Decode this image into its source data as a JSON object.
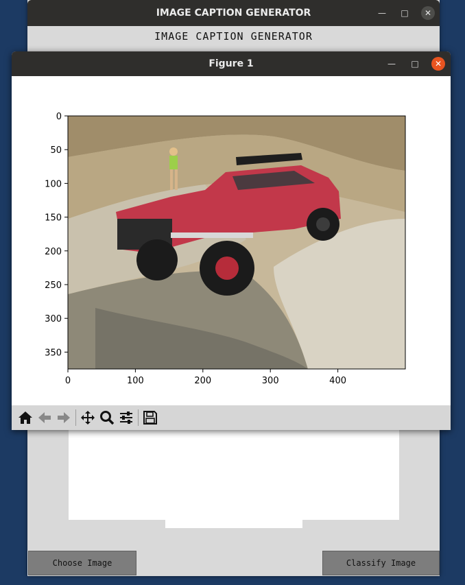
{
  "main_window": {
    "title": "IMAGE CAPTION GENERATOR",
    "header_label": "IMAGE CAPTION GENERATOR",
    "choose_button": "Choose Image",
    "classify_button": "Classify Image"
  },
  "figure_window": {
    "title": "Figure 1",
    "plot": {
      "x_ticks": [
        "0",
        "100",
        "200",
        "300",
        "400"
      ],
      "y_ticks": [
        "0",
        "50",
        "100",
        "150",
        "200",
        "250",
        "300",
        "350"
      ]
    },
    "toolbar": [
      "home-icon",
      "back-icon",
      "forward-icon",
      "pan-icon",
      "zoom-icon",
      "configure-icon",
      "save-icon"
    ]
  },
  "colors": {
    "desktop": "#1c3a63",
    "titlebar": "#2f2e2c",
    "close_accent": "#e95420"
  }
}
